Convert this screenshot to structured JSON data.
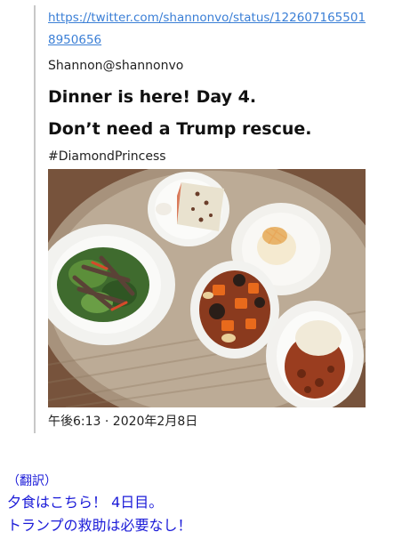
{
  "tweet": {
    "url": "https://twitter.com/shannonvo/status/1226071655018950656",
    "author": "Shannon@shannonvo",
    "text_line1": "Dinner is here! Day 4.",
    "text_line2": "Don’t need a Trump rescue.",
    "hashtag": "#DiamondPrincess",
    "timestamp": "午後6:13 · 2020年2月8日",
    "photo_icon": "dinner-photo"
  },
  "translation": {
    "header": "（翻訳）",
    "line1": "夕食はこちら！ 4日目。",
    "line2": "トランプの救助は必要なし！"
  },
  "colors": {
    "link": "#3b7fd6",
    "translation": "#1a1ad8",
    "quote_bar": "#c8c8c8"
  }
}
